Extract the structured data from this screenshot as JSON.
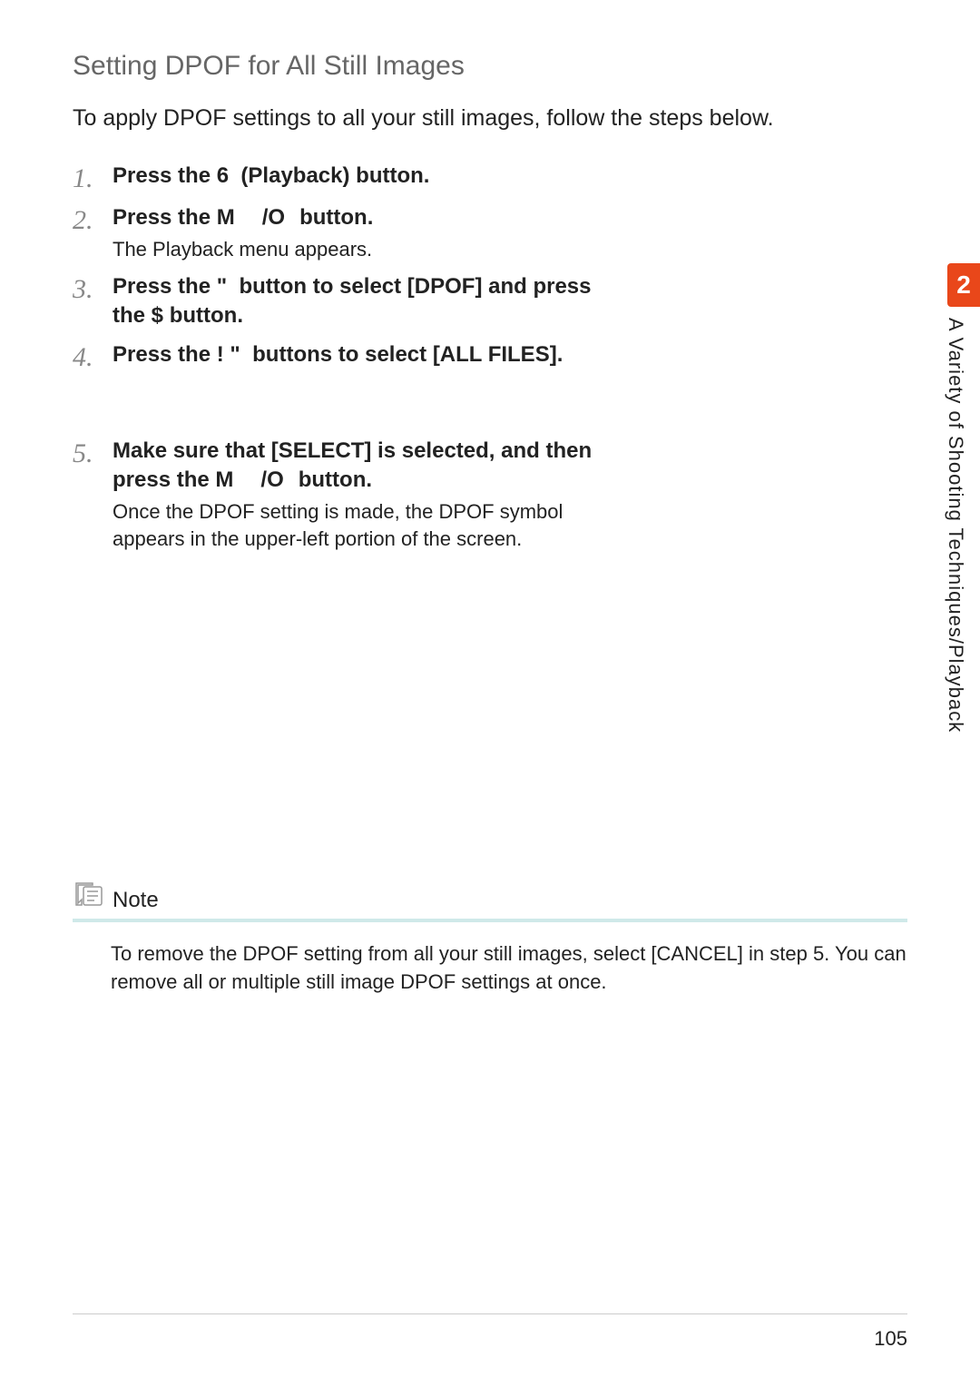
{
  "heading": "Setting DPOF for All Still Images",
  "intro": "To apply DPOF settings to all your still images, follow the steps below.",
  "steps": [
    {
      "num": "1.",
      "title": "Press the 6 (Playback) button."
    },
    {
      "num": "2.",
      "title": "Press the M /O button.",
      "sub": "The Playback menu appears."
    },
    {
      "num": "3.",
      "title": "Press the \" button to select [DPOF] and press the $ button."
    },
    {
      "num": "4.",
      "title": "Press the !\" buttons to select [ALL FILES]."
    },
    {
      "num": "5.",
      "title": "Make sure that [SELECT] is selected, and then press the M /O button.",
      "sub": "Once the DPOF setting is made, the DPOF symbol appears in the upper-left portion of the screen."
    }
  ],
  "side_tab": "2",
  "side_label": "A Variety of Shooting Techniques/Playback",
  "note_label": "Note",
  "note_text": "To remove the DPOF setting from all your still images, select [CANCEL] in step 5. You can remove all or multiple still image DPOF settings at once.",
  "page_number": "105"
}
